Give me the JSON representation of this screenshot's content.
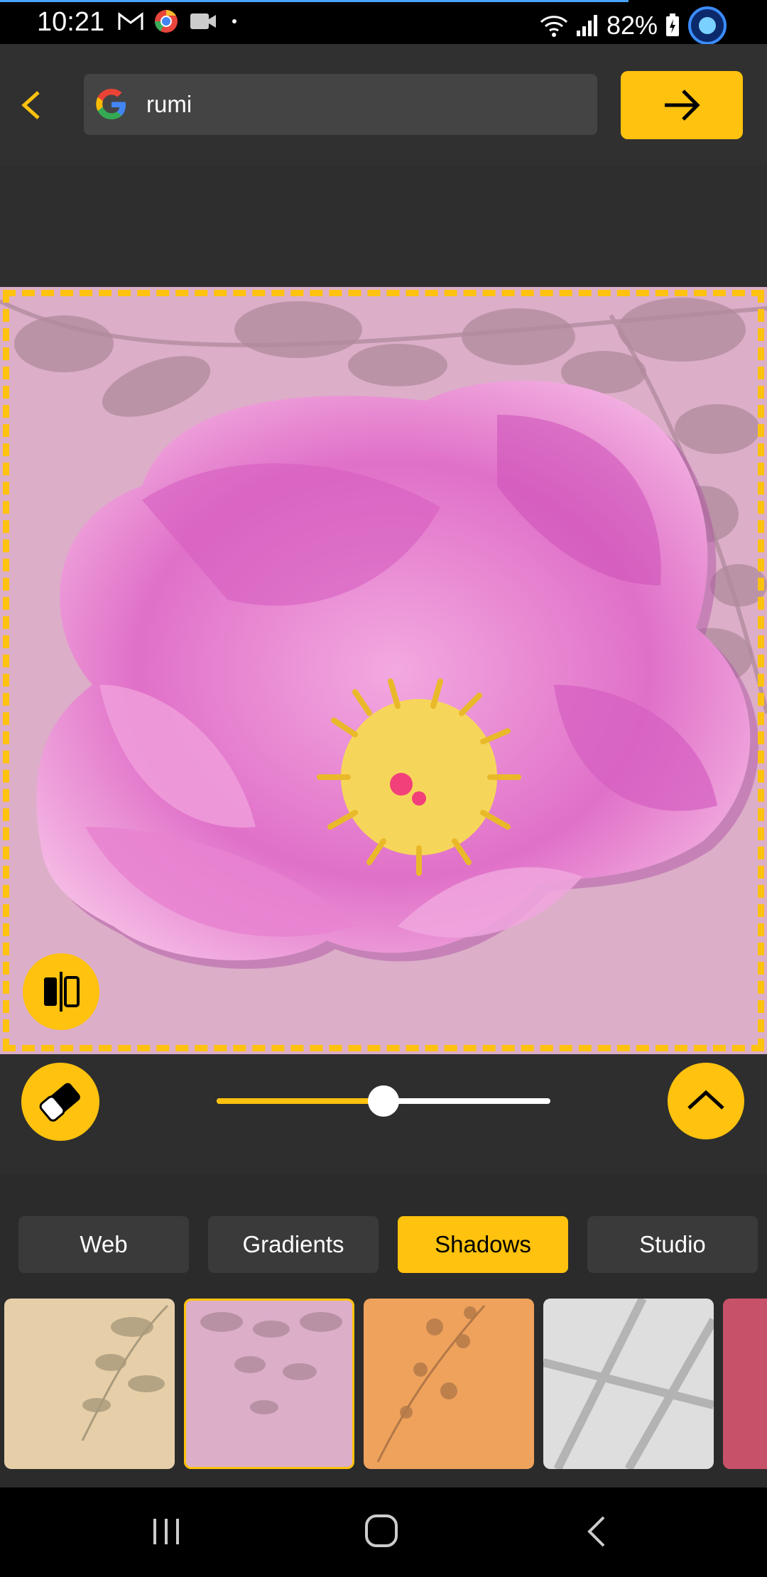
{
  "status_bar": {
    "time": "10:21",
    "battery_percent": "82%",
    "notification_icons": [
      "gmail-icon",
      "chrome-icon",
      "video-icon",
      "dot-icon"
    ],
    "system_icons": [
      "wifi-icon",
      "signal-icon",
      "battery-icon"
    ]
  },
  "search": {
    "query": "rumi",
    "provider_icon": "google-icon",
    "go_icon": "arrow-right-icon"
  },
  "canvas": {
    "background": "pink-shadow-leaves",
    "subject": "pink peony flower"
  },
  "controls": {
    "slider_value_fraction": 0.5,
    "eraser_icon": "eraser-icon",
    "expand_icon": "chevron-up-icon",
    "compare_icon": "compare-icon"
  },
  "tabs": [
    {
      "label": "Web",
      "active": false
    },
    {
      "label": "Gradients",
      "active": false
    },
    {
      "label": "Shadows",
      "active": true
    },
    {
      "label": "Studio",
      "active": false
    }
  ],
  "swatches": [
    {
      "color": "#e6cfa8",
      "selected": false,
      "pattern": "leaf-shadow"
    },
    {
      "color": "#dcaec8",
      "selected": true,
      "pattern": "leaf-shadow"
    },
    {
      "color": "#efa25c",
      "selected": false,
      "pattern": "branch-shadow"
    },
    {
      "color": "#dedede",
      "selected": false,
      "pattern": "window-shadow"
    },
    {
      "color": "#c8516a",
      "selected": false,
      "pattern": "plain"
    }
  ],
  "colors": {
    "accent": "#ffc20e",
    "appbar": "#303030"
  },
  "nav": {
    "recents_icon": "recents-icon",
    "home_icon": "home-icon",
    "back_icon": "back-icon"
  }
}
